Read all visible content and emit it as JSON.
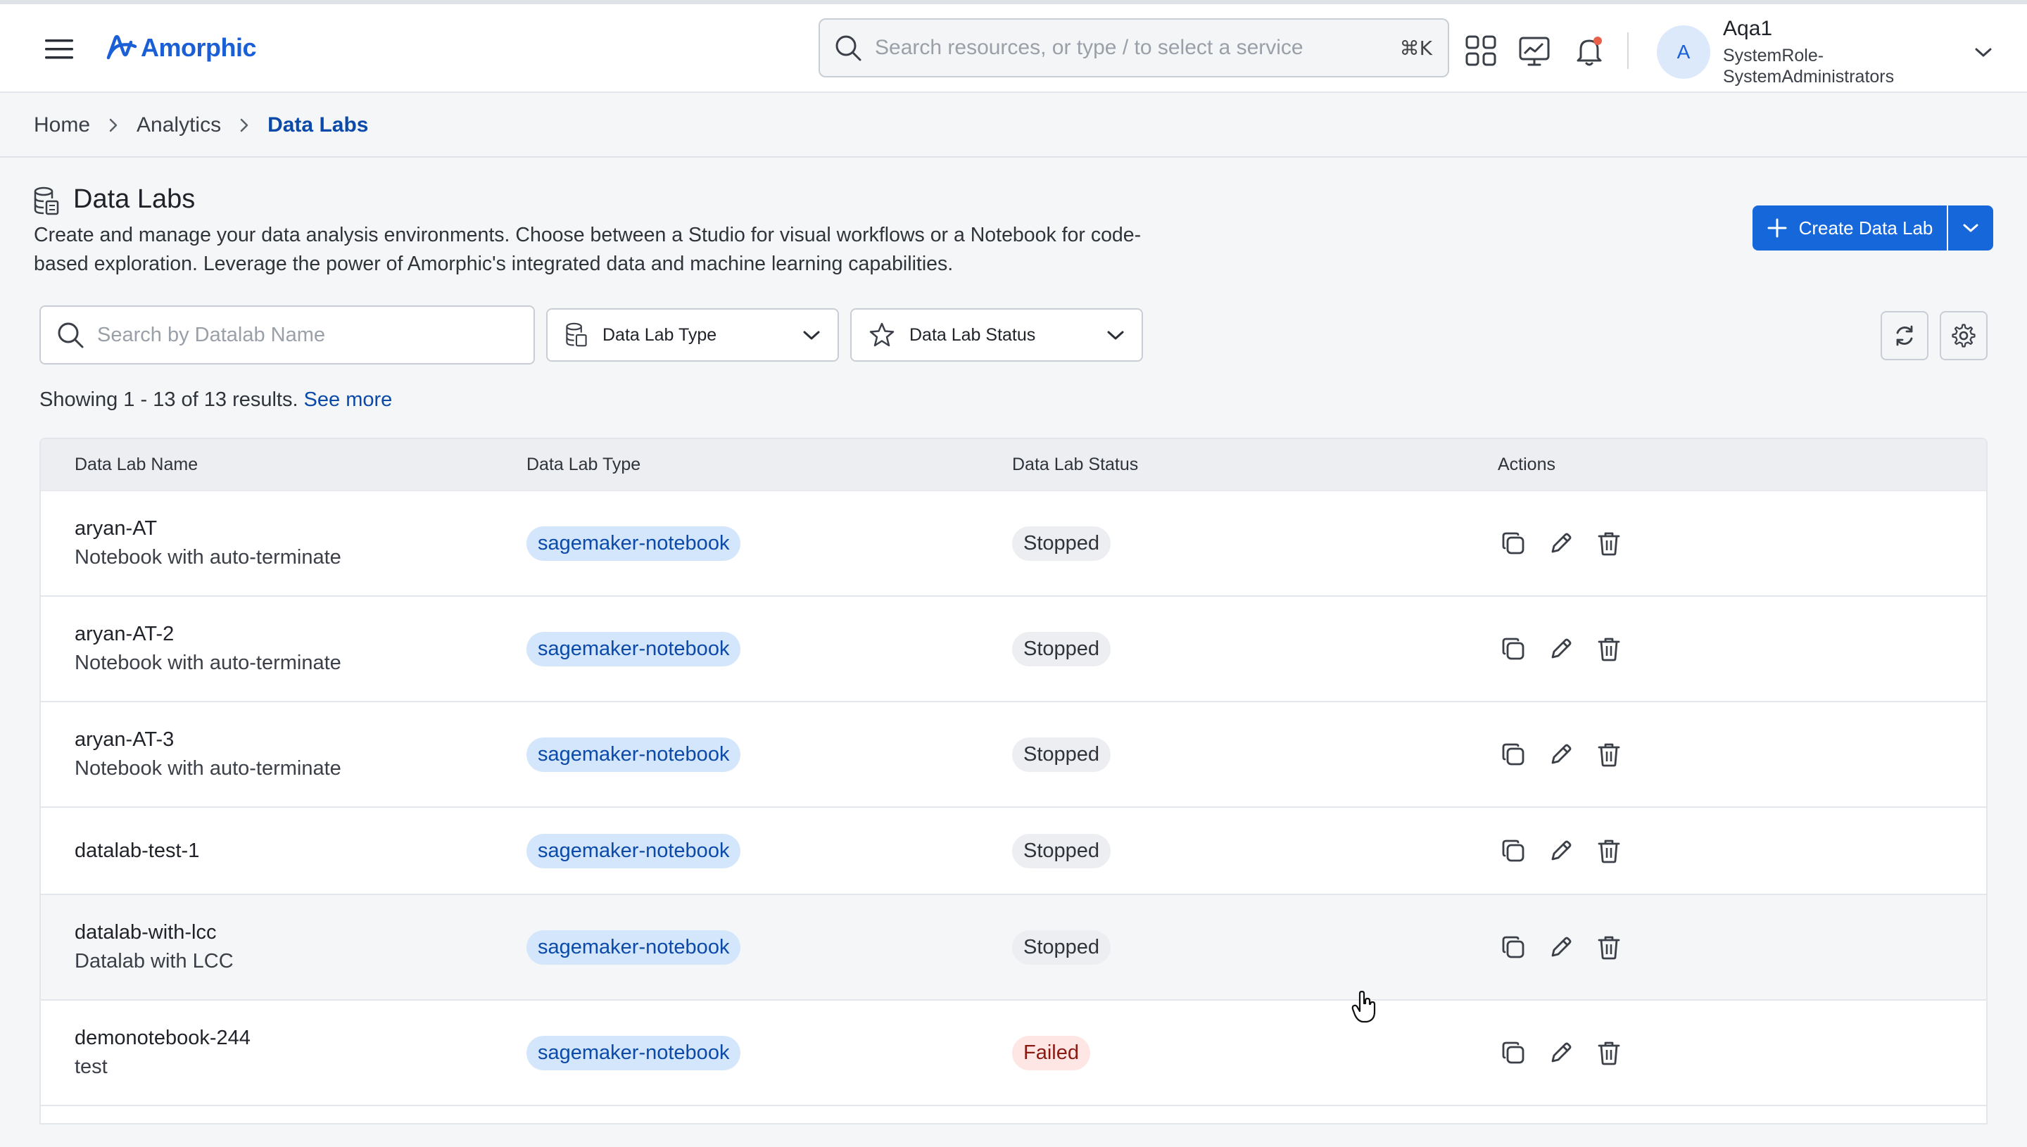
{
  "header": {
    "logo_text": "Amorphic",
    "search_placeholder": "Search resources, or type / to select a service",
    "search_shortcut": "⌘K",
    "user": {
      "avatar_initial": "A",
      "name": "Aqa1",
      "role": "SystemRole-SystemAdministrators"
    }
  },
  "breadcrumb": {
    "items": [
      "Home",
      "Analytics"
    ],
    "current": "Data Labs"
  },
  "page": {
    "title": "Data Labs",
    "description": "Create and manage your data analysis environments. Choose between a Studio for visual workflows or a Notebook for code-based exploration. Leverage the power of Amorphic's integrated data and machine learning capabilities.",
    "create_label": "Create Data Lab"
  },
  "filters": {
    "search_placeholder": "Search by Datalab Name",
    "type_label": "Data Lab Type",
    "status_label": "Data Lab Status"
  },
  "results": {
    "text": "Showing 1 - 13 of 13 results.",
    "see_more": "See more"
  },
  "table": {
    "columns": [
      "Data Lab Name",
      "Data Lab Type",
      "Data Lab Status",
      "Actions"
    ],
    "rows": [
      {
        "name": "aryan-AT",
        "desc": "Notebook with auto-terminate",
        "type": "sagemaker-notebook",
        "status": "Stopped"
      },
      {
        "name": "aryan-AT-2",
        "desc": "Notebook with auto-terminate",
        "type": "sagemaker-notebook",
        "status": "Stopped"
      },
      {
        "name": "aryan-AT-3",
        "desc": "Notebook with auto-terminate",
        "type": "sagemaker-notebook",
        "status": "Stopped"
      },
      {
        "name": "datalab-test-1",
        "desc": "",
        "type": "sagemaker-notebook",
        "status": "Stopped"
      },
      {
        "name": "datalab-with-lcc",
        "desc": "Datalab with LCC",
        "type": "sagemaker-notebook",
        "status": "Stopped"
      },
      {
        "name": "demonotebook-244",
        "desc": "test",
        "type": "sagemaker-notebook",
        "status": "Failed"
      }
    ]
  },
  "colors": {
    "primary": "#1667d9",
    "link": "#0b4aa8",
    "type_pill_bg": "#d4e6fb",
    "failed_text": "#8b1a12"
  }
}
